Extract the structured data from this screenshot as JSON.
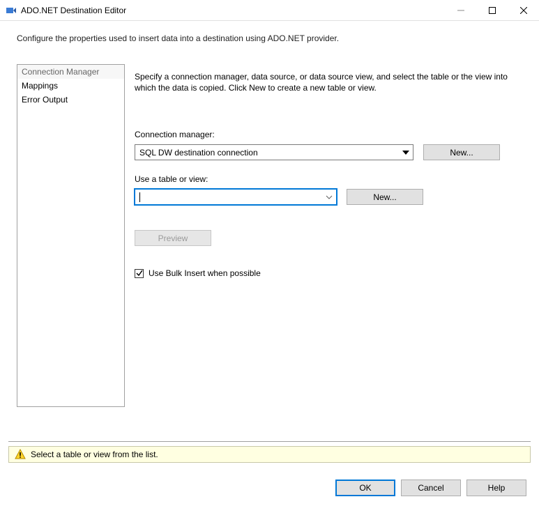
{
  "window": {
    "title": "ADO.NET Destination Editor"
  },
  "description": "Configure the properties used to insert data into a destination using ADO.NET provider.",
  "sidebar": {
    "items": [
      {
        "label": "Connection Manager"
      },
      {
        "label": "Mappings"
      },
      {
        "label": "Error Output"
      }
    ]
  },
  "panel": {
    "intro": "Specify a connection manager, data source, or data source view, and select the table or the view into which the data is copied. Click New to create a new table or view.",
    "conn_label": "Connection manager:",
    "conn_value": "SQL DW destination connection",
    "table_label": "Use a table or view:",
    "table_value": "",
    "new_button": "New...",
    "preview_button": "Preview",
    "bulk_checkbox_label": "Use Bulk Insert when possible",
    "bulk_checked": true
  },
  "status": {
    "message": "Select a table or view from the list."
  },
  "footer": {
    "ok": "OK",
    "cancel": "Cancel",
    "help": "Help"
  }
}
